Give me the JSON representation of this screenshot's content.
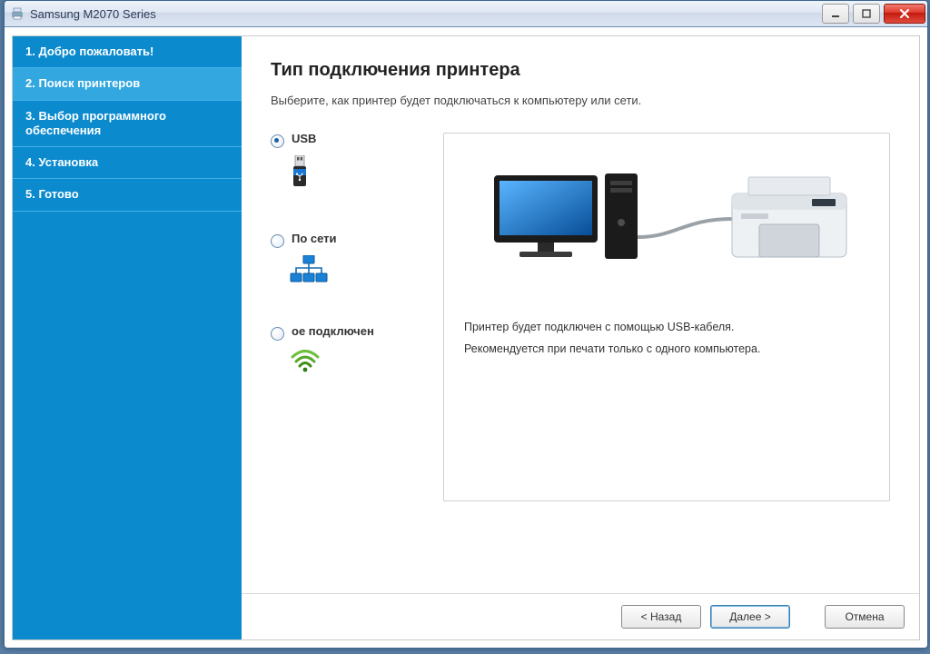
{
  "window": {
    "title": "Samsung M2070 Series"
  },
  "sidebar": {
    "items": [
      {
        "label": "1. Добро пожаловать!"
      },
      {
        "label": "2. Поиск принтеров"
      },
      {
        "label": "3. Выбор программного обеспечения"
      },
      {
        "label": "4. Установка"
      },
      {
        "label": "5. Готово"
      }
    ],
    "active_index": 1
  },
  "page": {
    "heading": "Тип подключения принтера",
    "subtitle": "Выберите, как принтер будет подключаться к компьютеру или сети."
  },
  "options": {
    "usb": {
      "label": "USB",
      "selected": true
    },
    "network": {
      "label": "По сети",
      "selected": false
    },
    "wireless": {
      "label": "ое подключен",
      "selected": false
    }
  },
  "description": {
    "line1": "Принтер будет подключен с помощью USB-кабеля.",
    "line2": "Рекомендуется при печати только с одного компьютера."
  },
  "buttons": {
    "back": "< Назад",
    "next": "Далее >",
    "cancel": "Отмена"
  }
}
